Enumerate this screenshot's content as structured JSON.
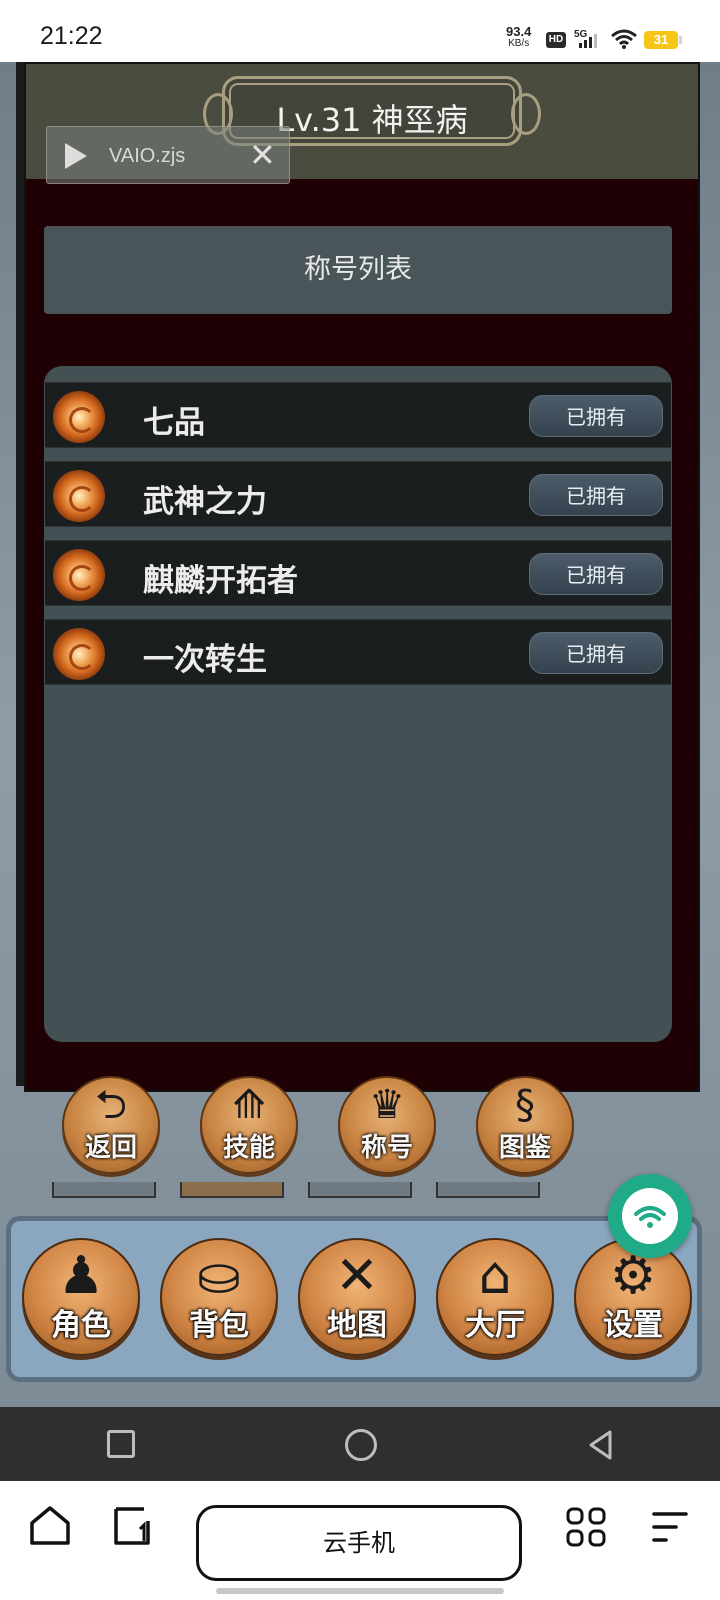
{
  "status_bar": {
    "time": "21:22",
    "net_speed_value": "93.4",
    "net_speed_unit": "KB/s",
    "hd_label": "HD",
    "network_label": "5G",
    "battery": "31"
  },
  "game": {
    "panel_title": "Lv.31 神巠病",
    "recorder": {
      "filename": "VAIO.zjs",
      "close_symbol": "✕"
    },
    "list_title": "称号列表",
    "titles": [
      {
        "name": "七品",
        "status": "已拥有"
      },
      {
        "name": "武神之力",
        "status": "已拥有"
      },
      {
        "name": "麒麟开拓者",
        "status": "已拥有"
      },
      {
        "name": "一次转生",
        "status": "已拥有"
      }
    ],
    "sub_menu": [
      {
        "label": "返回",
        "icon": "back-arrow-icon",
        "glyph": "⮌"
      },
      {
        "label": "技能",
        "icon": "skill-icon",
        "glyph": "⟰"
      },
      {
        "label": "称号",
        "icon": "crown-icon",
        "glyph": "♛"
      },
      {
        "label": "图鉴",
        "icon": "dragon-icon",
        "glyph": "§"
      }
    ],
    "main_menu": [
      {
        "label": "角色",
        "icon": "wizard-icon",
        "glyph": "♟"
      },
      {
        "label": "背包",
        "icon": "bag-icon",
        "glyph": "⛀"
      },
      {
        "label": "地图",
        "icon": "crossed-swords-icon",
        "glyph": "✕"
      },
      {
        "label": "大厅",
        "icon": "house-icon",
        "glyph": "⌂"
      },
      {
        "label": "设置",
        "icon": "gears-icon",
        "glyph": "⚙"
      }
    ]
  },
  "browser": {
    "url_label": "云手机"
  },
  "colors": {
    "panel_bg": "#1f0004",
    "list_bg": "#445154",
    "accent_orange": "#d08545",
    "fab_green": "#1fab88"
  }
}
